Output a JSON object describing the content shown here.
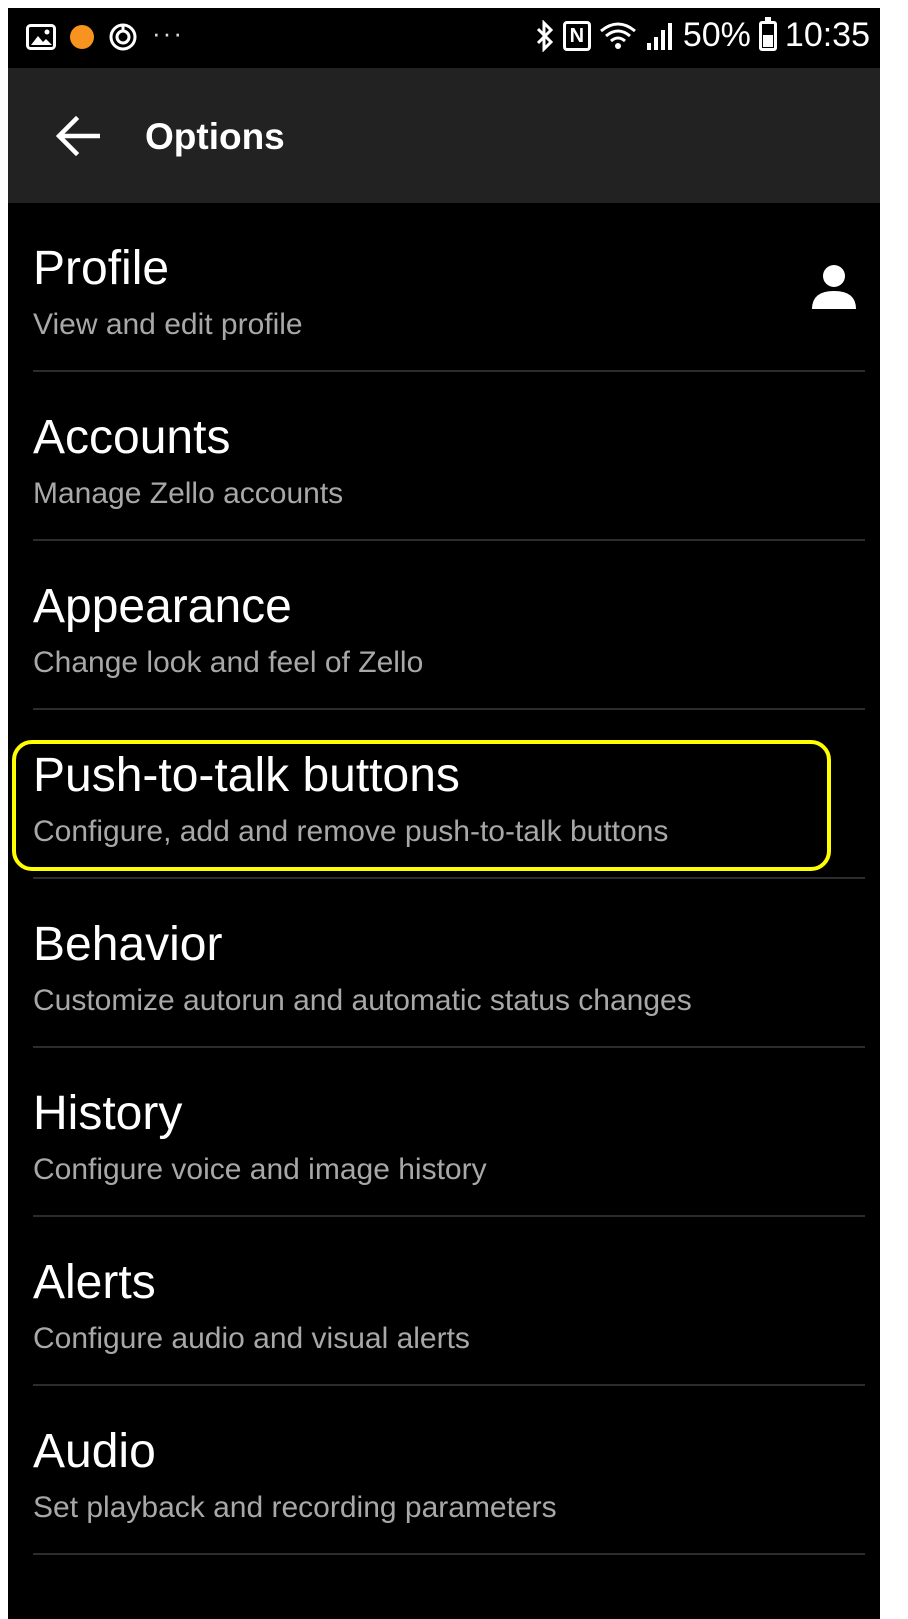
{
  "status_bar": {
    "battery": "50%",
    "time": "10:35",
    "nfc_label": "N",
    "more": "···"
  },
  "toolbar": {
    "title": "Options"
  },
  "options": [
    {
      "title": "Profile",
      "subtitle": "View and edit profile"
    },
    {
      "title": "Accounts",
      "subtitle": "Manage Zello accounts"
    },
    {
      "title": "Appearance",
      "subtitle": "Change look and feel of Zello"
    },
    {
      "title": "Push-to-talk buttons",
      "subtitle": "Configure, add and remove push-to-talk buttons"
    },
    {
      "title": "Behavior",
      "subtitle": "Customize autorun and automatic status changes"
    },
    {
      "title": "History",
      "subtitle": "Configure voice and image history"
    },
    {
      "title": "Alerts",
      "subtitle": "Configure audio and visual alerts"
    },
    {
      "title": "Audio",
      "subtitle": "Set playback and recording parameters"
    }
  ],
  "colors": {
    "background": "#000000",
    "toolbar": "#222222",
    "title_text": "#ffffff",
    "subtitle_text": "#a8a8a8",
    "highlight": "#ffff00",
    "notification_dot": "#f7931e"
  }
}
